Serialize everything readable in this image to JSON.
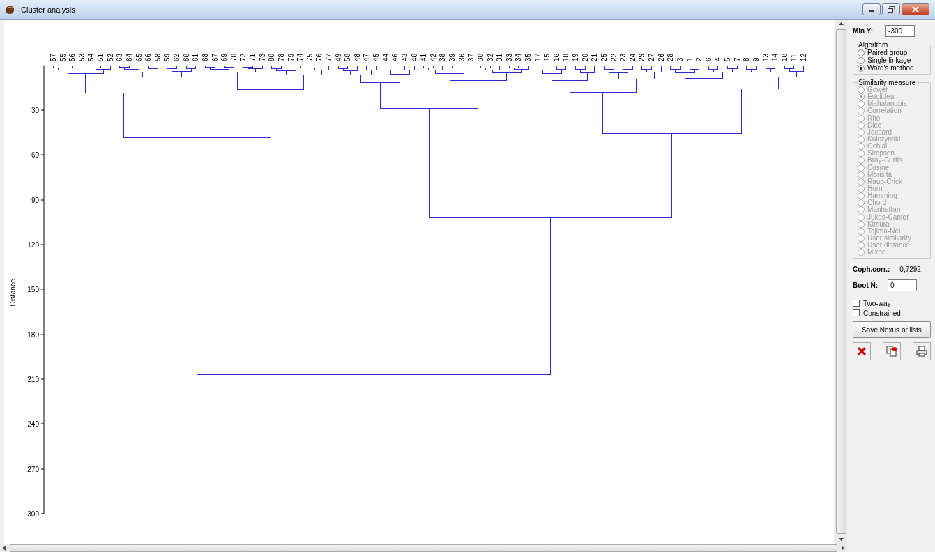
{
  "window": {
    "title": "Cluster analysis"
  },
  "plot": {
    "ylabel": "Distance",
    "yticks": [
      "30",
      "60",
      "90",
      "120",
      "150",
      "180",
      "210",
      "240",
      "270",
      "300"
    ],
    "leaves": [
      "57",
      "55",
      "56",
      "53",
      "54",
      "51",
      "52",
      "63",
      "64",
      "65",
      "66",
      "58",
      "59",
      "62",
      "60",
      "61",
      "68",
      "67",
      "69",
      "70",
      "72",
      "71",
      "73",
      "80",
      "78",
      "79",
      "74",
      "75",
      "76",
      "77",
      "49",
      "50",
      "48",
      "47",
      "45",
      "44",
      "46",
      "43",
      "40",
      "41",
      "42",
      "38",
      "39",
      "36",
      "37",
      "30",
      "32",
      "31",
      "33",
      "34",
      "35",
      "17",
      "15",
      "16",
      "18",
      "19",
      "20",
      "21",
      "25",
      "22",
      "23",
      "24",
      "29",
      "27",
      "26",
      "28",
      "3",
      "1",
      "2",
      "6",
      "4",
      "5",
      "7",
      "8",
      "9",
      "13",
      "14",
      "10",
      "11",
      "12"
    ]
  },
  "panel": {
    "min_y": {
      "label": "Min Y:",
      "value": "-300"
    },
    "algorithm": {
      "title": "Algorithm",
      "options": [
        {
          "label": "Paired group",
          "selected": false
        },
        {
          "label": "Single linkage",
          "selected": false
        },
        {
          "label": "Ward's method",
          "selected": true
        }
      ]
    },
    "similarity": {
      "title": "Similarity measure",
      "disabled": true,
      "options": [
        {
          "label": "Gower",
          "selected": false
        },
        {
          "label": "Euclidean",
          "selected": true
        },
        {
          "label": "Mahalanobis",
          "selected": false
        },
        {
          "label": "Correlation",
          "selected": false
        },
        {
          "label": "Rho",
          "selected": false
        },
        {
          "label": "Dice",
          "selected": false
        },
        {
          "label": "Jaccard",
          "selected": false
        },
        {
          "label": "Kulczynski",
          "selected": false
        },
        {
          "label": "Ochiai",
          "selected": false
        },
        {
          "label": "Simpson",
          "selected": false
        },
        {
          "label": "Bray-Curtis",
          "selected": false
        },
        {
          "label": "Cosine",
          "selected": false
        },
        {
          "label": "Morisita",
          "selected": false
        },
        {
          "label": "Raup-Crick",
          "selected": false
        },
        {
          "label": "Horn",
          "selected": false
        },
        {
          "label": "Hamming",
          "selected": false
        },
        {
          "label": "Chord",
          "selected": false
        },
        {
          "label": "Manhattan",
          "selected": false
        },
        {
          "label": "Jukes-Cantor",
          "selected": false
        },
        {
          "label": "Kimura",
          "selected": false
        },
        {
          "label": "Tajima-Nei",
          "selected": false
        },
        {
          "label": "User similarity",
          "selected": false
        },
        {
          "label": "User distance",
          "selected": false
        },
        {
          "label": "Mixed",
          "selected": false
        }
      ]
    },
    "coph_corr": {
      "label": "Coph.corr.:",
      "value": "0,7292"
    },
    "boot_n": {
      "label": "Boot N:",
      "value": "0"
    },
    "checkboxes": [
      {
        "label": "Two-way",
        "checked": false
      },
      {
        "label": "Constrained",
        "checked": false
      }
    ],
    "save_button": "Save Nexus or lists"
  }
}
